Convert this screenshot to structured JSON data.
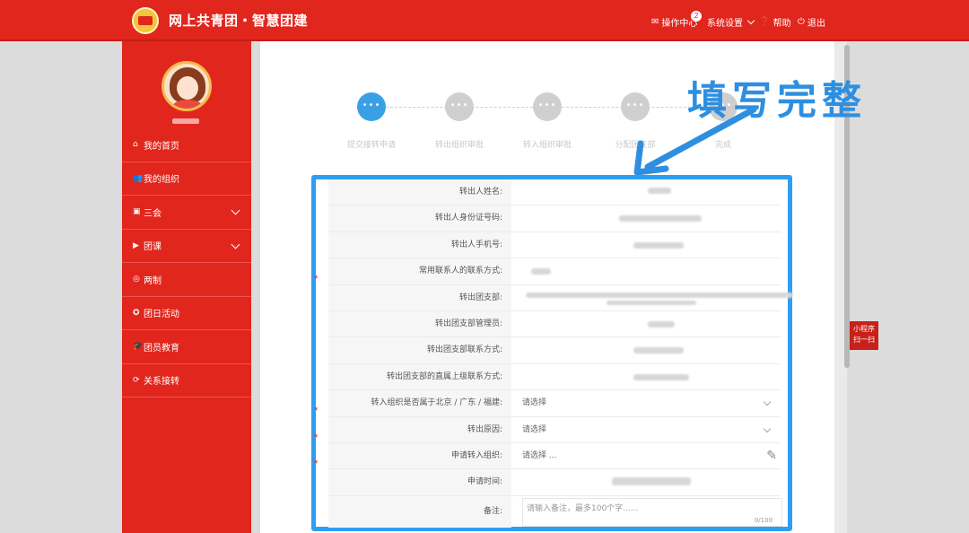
{
  "header": {
    "title": "网上共青团・智慧团建",
    "ops_label": "操作中心",
    "ops_badge": "2",
    "settings_label": "系统设置",
    "help_label": "帮助",
    "logout_label": "退出"
  },
  "sidebar": {
    "items": [
      {
        "label": "我的首页",
        "icon": "home-icon"
      },
      {
        "label": "我的组织",
        "icon": "group-icon"
      },
      {
        "label": "三会",
        "icon": "doc-icon"
      },
      {
        "label": "团课",
        "icon": "course-icon"
      },
      {
        "label": "两制",
        "icon": "target-icon"
      },
      {
        "label": "团日活动",
        "icon": "activity-icon"
      },
      {
        "label": "团员教育",
        "icon": "graduation-icon"
      },
      {
        "label": "关系接转",
        "icon": "refresh-icon"
      }
    ]
  },
  "steps": [
    {
      "label": "提交接转申请",
      "mark": "•••"
    },
    {
      "label": "转出组织审批",
      "mark": "•••"
    },
    {
      "label": "转入组织审批",
      "mark": "•••"
    },
    {
      "label": "分配团支部",
      "mark": "•••"
    },
    {
      "label": "完成",
      "mark": "•••"
    }
  ],
  "annotation": "填写完整",
  "form": {
    "rows": [
      {
        "label": "转出人姓名:",
        "required": false
      },
      {
        "label": "转出人身份证号码:",
        "required": false
      },
      {
        "label": "转出人手机号:",
        "required": false
      },
      {
        "label": "常用联系人的联系方式:",
        "required": true
      },
      {
        "label": "转出团支部:",
        "required": false
      },
      {
        "label": "转出团支部管理员:",
        "required": false
      },
      {
        "label": "转出团支部联系方式:",
        "required": false
      },
      {
        "label": "转出团支部的直属上级联系方式:",
        "required": false
      },
      {
        "label": "转入组织是否属于北京 / 广东 / 福建:",
        "required": true,
        "value": "请选择"
      },
      {
        "label": "转出原因:",
        "required": true,
        "value": "请选择"
      },
      {
        "label": "申请转入组织:",
        "required": true,
        "value": "请选择 ..."
      },
      {
        "label": "申请时间:",
        "required": false
      },
      {
        "label": "备注:",
        "required": false,
        "placeholder": "请输入备注，最多100个字......",
        "counter": "0/100"
      }
    ],
    "required_mark": "*"
  },
  "mini_program": {
    "line1": "小程序",
    "line2": "扫一扫"
  }
}
